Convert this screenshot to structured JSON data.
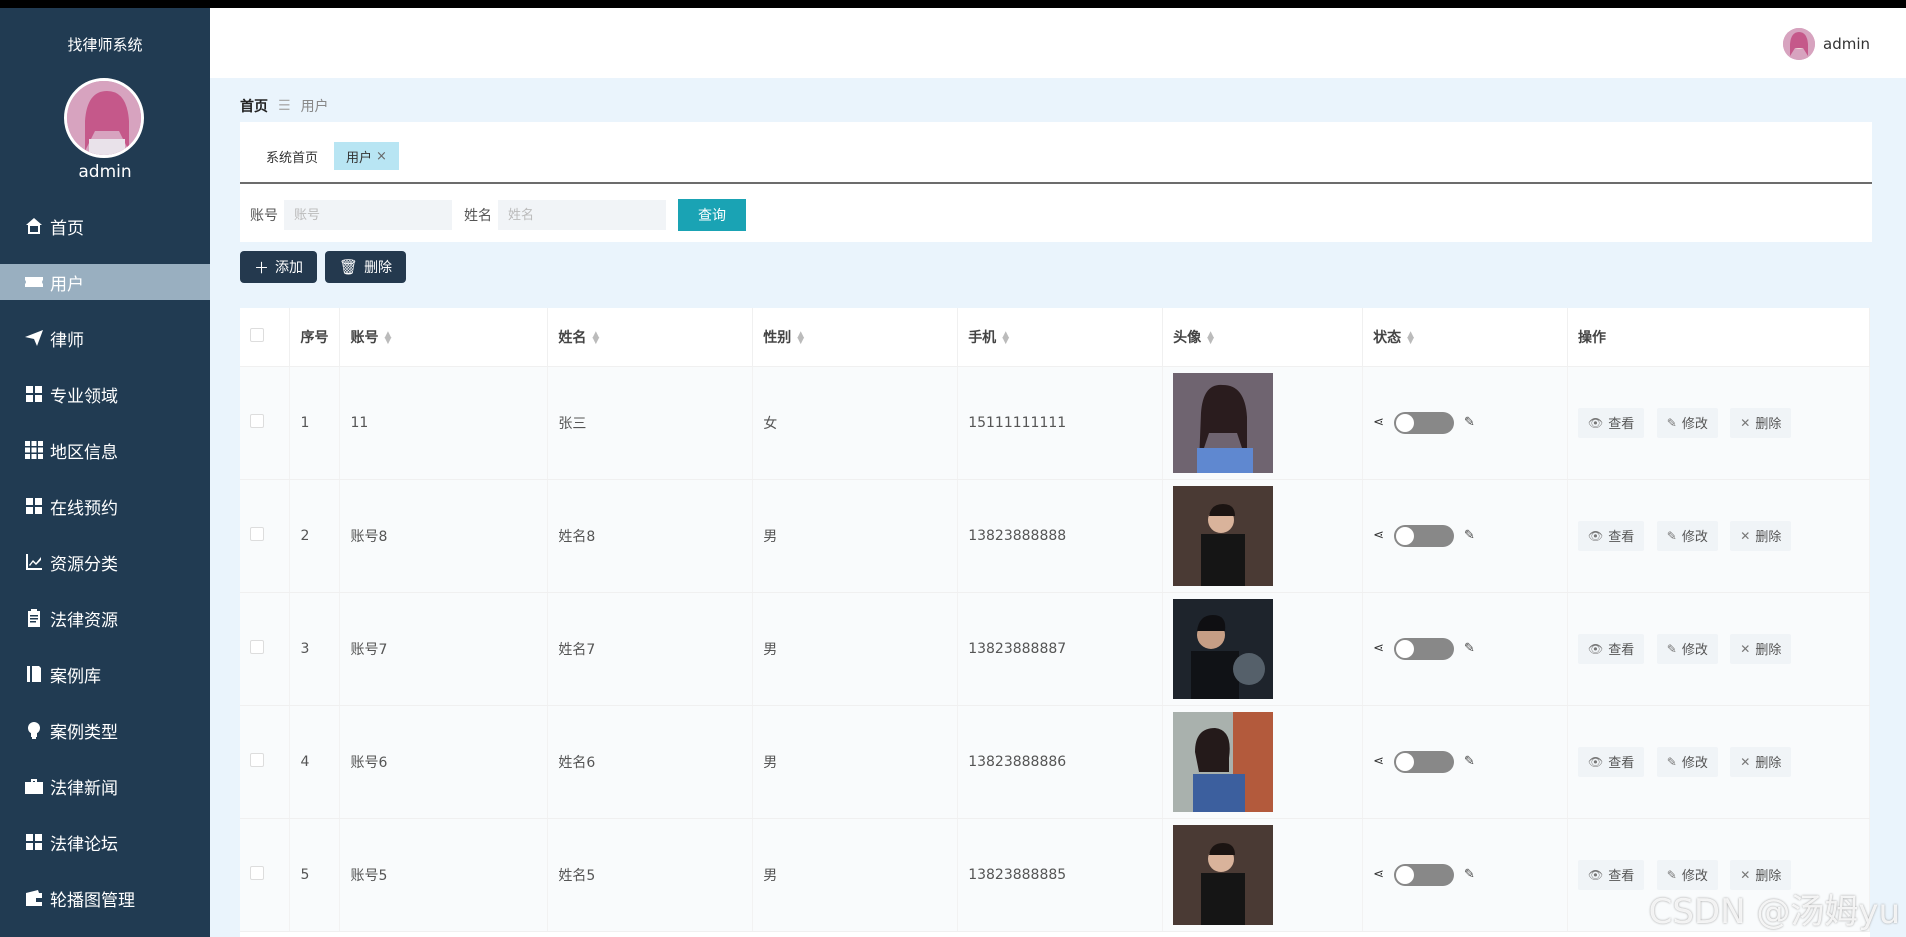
{
  "sidebar": {
    "system_title": "找律师系统",
    "user_name": "admin",
    "items": [
      {
        "label": "首页",
        "icon": "home-icon"
      },
      {
        "label": "用户",
        "icon": "ticket-icon",
        "active": true
      },
      {
        "label": "律师",
        "icon": "send-icon"
      },
      {
        "label": "专业领域",
        "icon": "grid-icon"
      },
      {
        "label": "地区信息",
        "icon": "grid9-icon"
      },
      {
        "label": "在线预约",
        "icon": "grid-icon"
      },
      {
        "label": "资源分类",
        "icon": "chart-icon"
      },
      {
        "label": "法律资源",
        "icon": "clipboard-icon"
      },
      {
        "label": "案例库",
        "icon": "book-icon"
      },
      {
        "label": "案例类型",
        "icon": "bulb-icon"
      },
      {
        "label": "法律新闻",
        "icon": "briefcase-icon"
      },
      {
        "label": "法律论坛",
        "icon": "grid-icon"
      },
      {
        "label": "轮播图管理",
        "icon": "wallet-icon"
      }
    ]
  },
  "header": {
    "user_name": "admin"
  },
  "breadcrumb": {
    "home": "首页",
    "current": "用户"
  },
  "tabs": [
    {
      "label": "系统首页"
    },
    {
      "label": "用户",
      "closable_symbol": "×"
    }
  ],
  "search": {
    "account_label": "账号",
    "account_placeholder": "账号",
    "name_label": "姓名",
    "name_placeholder": "姓名",
    "query_label": "查询"
  },
  "actions": {
    "add_label": "添加",
    "delete_label": "删除"
  },
  "table": {
    "headers": {
      "index": "序号",
      "account": "账号",
      "name": "姓名",
      "gender": "性别",
      "phone": "手机",
      "avatar": "头像",
      "status": "状态",
      "ops": "操作"
    },
    "op_labels": {
      "view": "查看",
      "edit": "修改",
      "delete": "删除"
    },
    "rows": [
      {
        "index": "1",
        "account": "11",
        "name": "张三",
        "gender": "女",
        "phone": "15111111111"
      },
      {
        "index": "2",
        "account": "账号8",
        "name": "姓名8",
        "gender": "男",
        "phone": "13823888888"
      },
      {
        "index": "3",
        "account": "账号7",
        "name": "姓名7",
        "gender": "男",
        "phone": "13823888887"
      },
      {
        "index": "4",
        "account": "账号6",
        "name": "姓名6",
        "gender": "男",
        "phone": "13823888886"
      },
      {
        "index": "5",
        "account": "账号5",
        "name": "姓名5",
        "gender": "男",
        "phone": "13823888885"
      }
    ]
  },
  "watermark": "CSDN @汤姆yu"
}
